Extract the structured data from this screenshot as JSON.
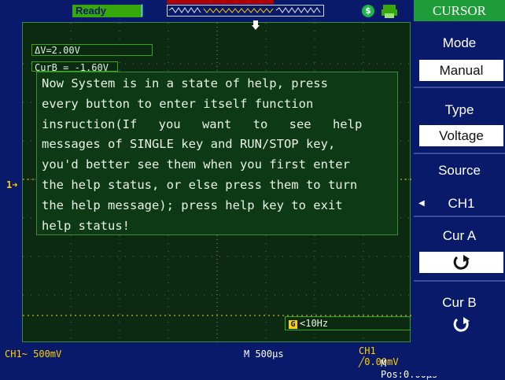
{
  "status": {
    "run_state": "Ready"
  },
  "menu": {
    "title": "CURSOR",
    "items": [
      {
        "label": "Mode",
        "value": "Manual"
      },
      {
        "label": "Type",
        "value": "Voltage"
      },
      {
        "label": "Source",
        "value": "CH1"
      },
      {
        "label": "Cur A",
        "value": ""
      },
      {
        "label": "Cur B",
        "value": ""
      }
    ]
  },
  "readouts": {
    "delta_v": "ΔV=2.00V",
    "cur_b": "CurB = -1.60V"
  },
  "help": {
    "lines": [
      "Now System is in a state of help, press",
      "every button to enter itself function",
      "insruction(If you want to see help",
      "messages of SINGLE key and RUN/STOP key,",
      "you'd better see them when you first enter",
      "the help status, or else press them to turn",
      "the help message); press help key to exit",
      "help status!"
    ]
  },
  "trigger_freq": "<10Hz",
  "trigger_freq_icon": "G",
  "bottom": {
    "ch1_scale": "CH1~ 500mV",
    "timebase": "M 500μs",
    "trigger": "CH1 ╱0.00mV",
    "m_pos": "M Pos:0.00μs"
  },
  "channel_marker": "1",
  "colors": {
    "screen_bg": "#0c2a12",
    "frame_bg": "#0a1a6a",
    "ready_green": "#37a80c",
    "menu_title": "#1f9c3a",
    "ch1_yellow": "#ffd000"
  }
}
